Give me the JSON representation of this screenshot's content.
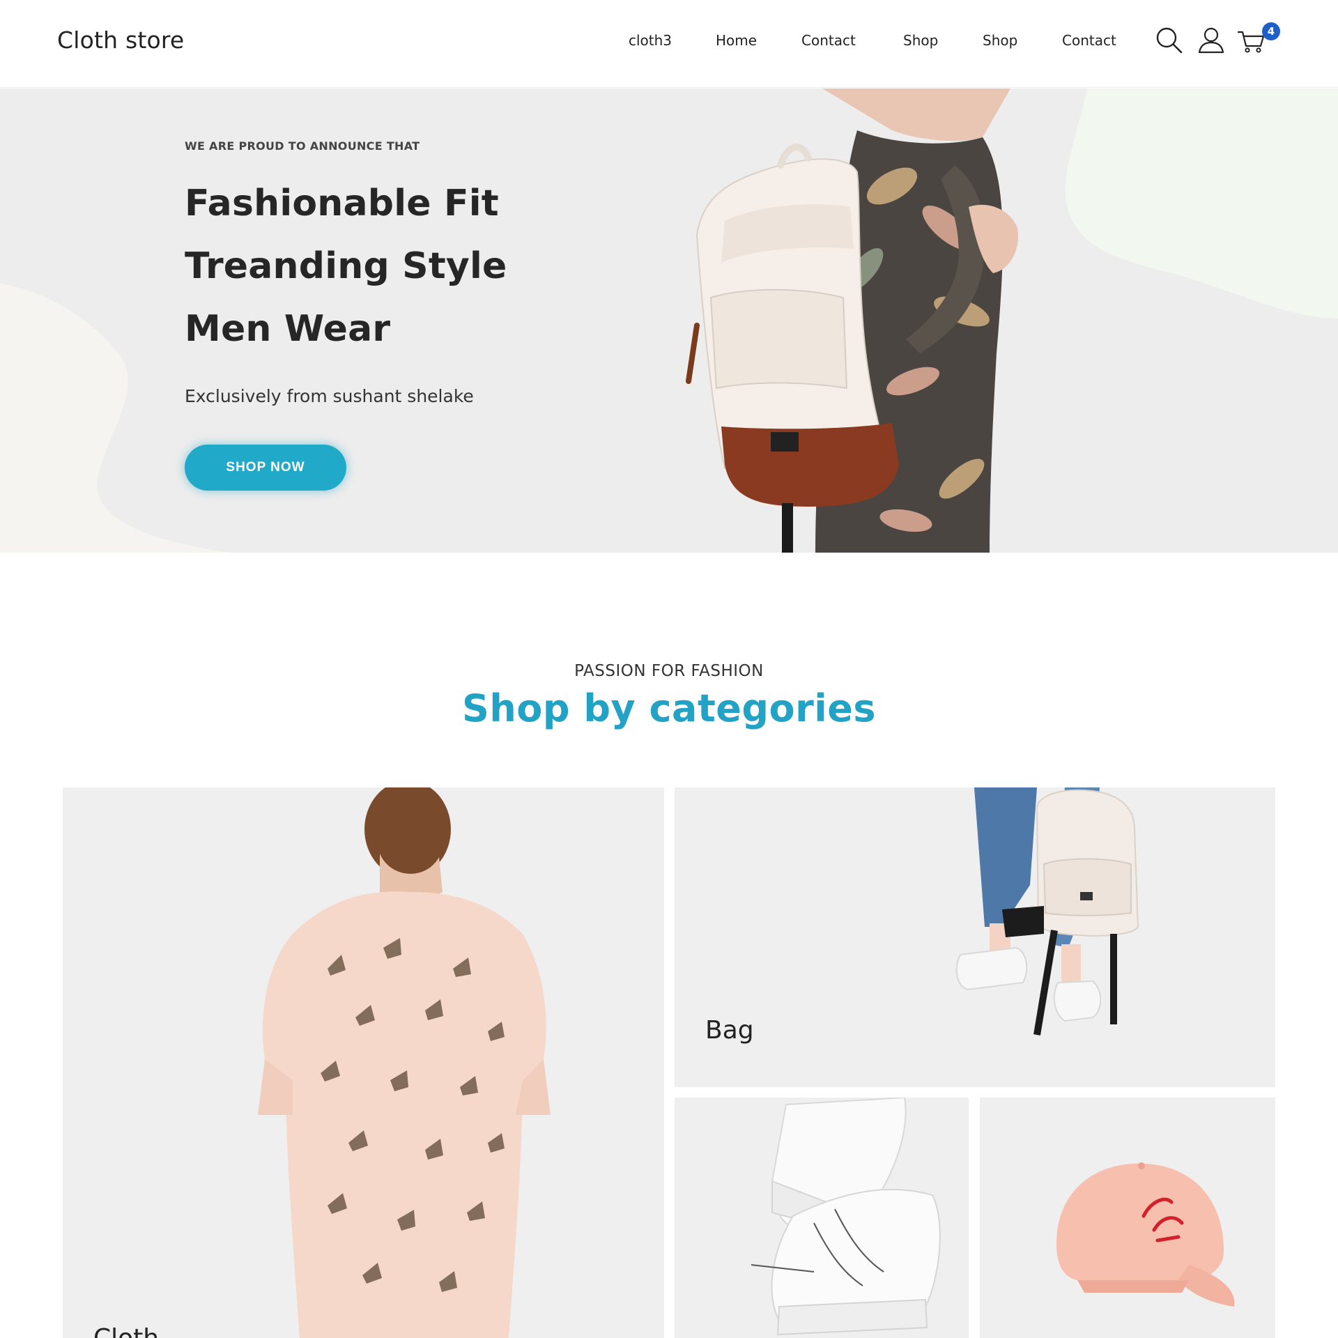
{
  "header": {
    "logo": "Cloth store",
    "nav": [
      "cloth3",
      "Home",
      "Contact",
      "Shop",
      "Shop",
      "Contact"
    ],
    "icons": [
      "search-icon",
      "user-icon",
      "cart-icon"
    ],
    "cart_count": "4"
  },
  "hero": {
    "eyebrow": "WE ARE PROUD TO ANNOUNCE THAT",
    "title_lines": [
      "Fashionable Fit",
      "Treanding Style",
      "Men Wear"
    ],
    "subtitle": "Exclusively from sushant shelake",
    "button": "SHOP NOW"
  },
  "categories": {
    "eyebrow": "PASSION FOR FASHION",
    "title": "Shop by categories",
    "tiles": [
      {
        "label": "Cloth"
      },
      {
        "label": "Bag"
      },
      {
        "label": ""
      },
      {
        "label": ""
      }
    ]
  },
  "colors": {
    "accent": "#20a9c9",
    "title_accent": "#22a2c4",
    "badge": "#1d5fc9",
    "hero_bg": "#ededed"
  }
}
